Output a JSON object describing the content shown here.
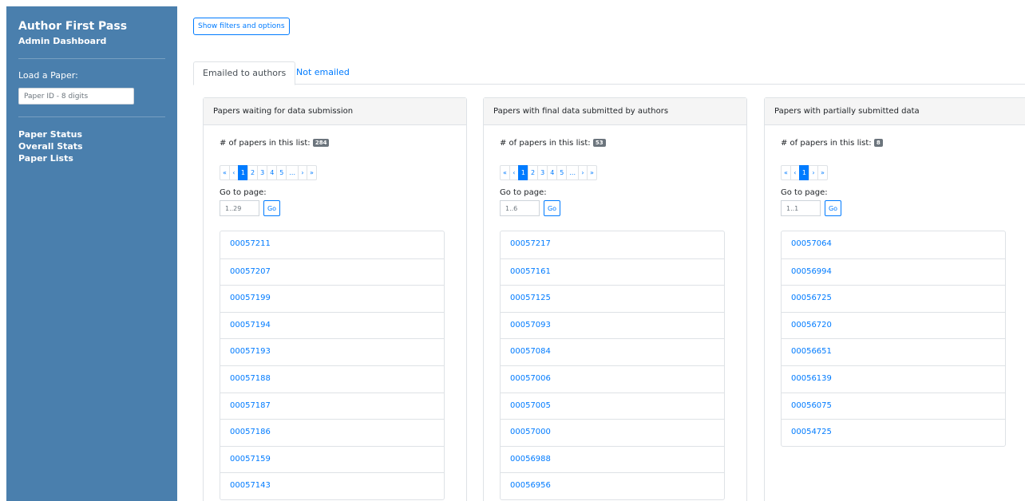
{
  "sidebar": {
    "app_title": "Author First Pass",
    "subtitle": "Admin Dashboard",
    "load_label": "Load a Paper:",
    "paper_input_placeholder": "Paper ID - 8 digits",
    "nav": [
      {
        "label": "Paper Status"
      },
      {
        "label": "Overall Stats"
      },
      {
        "label": "Paper Lists"
      }
    ]
  },
  "toolbar": {
    "filters_label": "Show filters and options"
  },
  "tabs": [
    {
      "label": "Emailed to authors",
      "active": true
    },
    {
      "label": "Not emailed",
      "active": false
    }
  ],
  "common": {
    "count_label": "# of papers in this list:",
    "goto_label": "Go to page:",
    "go_label": "Go"
  },
  "cards": [
    {
      "title": "Papers waiting for data submission",
      "count": "284",
      "pages": [
        "«",
        "‹",
        "1",
        "2",
        "3",
        "4",
        "5",
        "...",
        "›",
        "»"
      ],
      "active_page": "1",
      "goto_placeholder": "1..29",
      "papers": [
        "00057211",
        "00057207",
        "00057199",
        "00057194",
        "00057193",
        "00057188",
        "00057187",
        "00057186",
        "00057159",
        "00057143"
      ]
    },
    {
      "title": "Papers with final data submitted by authors",
      "count": "53",
      "pages": [
        "«",
        "‹",
        "1",
        "2",
        "3",
        "4",
        "5",
        "...",
        "›",
        "»"
      ],
      "active_page": "1",
      "goto_placeholder": "1..6",
      "papers": [
        "00057217",
        "00057161",
        "00057125",
        "00057093",
        "00057084",
        "00057006",
        "00057005",
        "00057000",
        "00056988",
        "00056956"
      ]
    },
    {
      "title": "Papers with partially submitted data",
      "count": "8",
      "pages": [
        "«",
        "‹",
        "1",
        "›",
        "»"
      ],
      "active_page": "1",
      "goto_placeholder": "1..1",
      "papers": [
        "00057064",
        "00056994",
        "00056725",
        "00056720",
        "00056651",
        "00056139",
        "00056075",
        "00054725"
      ]
    }
  ],
  "colors": {
    "sidebar_bg": "#4a7fad",
    "link": "#007bff",
    "badge": "#6c757d"
  }
}
